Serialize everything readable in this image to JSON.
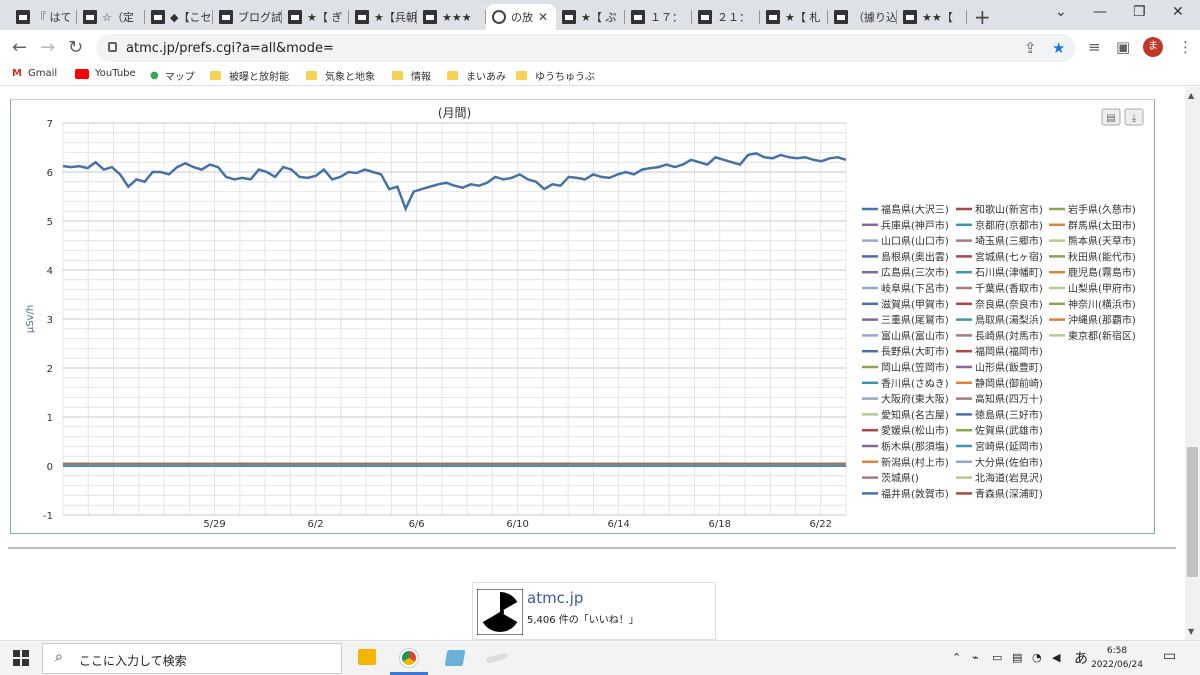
{
  "browser": {
    "tabs": [
      {
        "label": "『 はて"
      },
      {
        "label": "☆（定"
      },
      {
        "label": "◆【こセ"
      },
      {
        "label": "ブログ試"
      },
      {
        "label": "★【 ぎ"
      },
      {
        "label": "★【兵朝"
      },
      {
        "label": "★★★"
      },
      {
        "label": "の放",
        "active": true
      },
      {
        "label": "★【 ぷ"
      },
      {
        "label": "１７："
      },
      {
        "label": "２１："
      },
      {
        "label": "★【 札"
      },
      {
        "label": "（據り込"
      },
      {
        "label": "★★【"
      }
    ],
    "url": "atmc.jp/prefs.cgi?a=all&mode=",
    "avatar": "ま",
    "bookmarks": [
      "Gmail",
      "YouTube",
      "マップ",
      "被曝と放射能",
      "気象と地象",
      "情報",
      "まいあみ",
      "ゆうちゅうぶ"
    ]
  },
  "chart_data": {
    "type": "line",
    "title": "(月間)",
    "xlabel": "",
    "ylabel": "μSv/h",
    "ylim": [
      -1,
      7
    ],
    "yticks": [
      -1,
      0,
      1,
      2,
      3,
      4,
      5,
      6,
      7
    ],
    "xticks": [
      {
        "day": 6,
        "label": "5/29"
      },
      {
        "day": 10,
        "label": "6/2"
      },
      {
        "day": 14,
        "label": "6/6"
      },
      {
        "day": 18,
        "label": "6/10"
      },
      {
        "day": 22,
        "label": "6/14"
      },
      {
        "day": 26,
        "label": "6/18"
      },
      {
        "day": 30,
        "label": "6/22"
      }
    ],
    "xlim": [
      0,
      31
    ],
    "main_series": {
      "name": "福島県(大沢三)",
      "color": "#4572a7",
      "values": [
        6.12,
        6.1,
        6.12,
        6.08,
        6.2,
        6.05,
        6.1,
        5.95,
        5.7,
        5.85,
        5.8,
        6.0,
        6.0,
        5.95,
        6.1,
        6.18,
        6.1,
        6.05,
        6.15,
        6.1,
        5.9,
        5.85,
        5.88,
        5.85,
        6.05,
        6.0,
        5.9,
        6.1,
        6.05,
        5.9,
        5.88,
        5.92,
        6.05,
        5.85,
        5.9,
        6.0,
        5.98,
        6.05,
        6.0,
        5.95,
        5.65,
        5.7,
        5.25,
        5.6,
        5.65,
        5.7,
        5.75,
        5.78,
        5.72,
        5.68,
        5.75,
        5.72,
        5.78,
        5.9,
        5.85,
        5.88,
        5.95,
        5.85,
        5.8,
        5.65,
        5.75,
        5.72,
        5.9,
        5.88,
        5.85,
        5.95,
        5.9,
        5.88,
        5.95,
        6.0,
        5.95,
        6.05,
        6.08,
        6.1,
        6.15,
        6.1,
        6.15,
        6.25,
        6.2,
        6.15,
        6.3,
        6.25,
        6.2,
        6.15,
        6.35,
        6.38,
        6.3,
        6.28,
        6.35,
        6.3,
        6.28,
        6.3,
        6.25,
        6.22,
        6.28,
        6.3,
        6.25
      ]
    },
    "flat_series_value": 0.05,
    "legend": [
      {
        "name": "福島県(大沢三)",
        "color": "#4572a7"
      },
      {
        "name": "和歌山(新宮市)",
        "color": "#aa4643"
      },
      {
        "name": "岩手県(久慈市)",
        "color": "#89a54e"
      },
      {
        "name": "兵庫県(神戸市)",
        "color": "#80699b"
      },
      {
        "name": "京都府(京都市)",
        "color": "#3d96ae"
      },
      {
        "name": "群馬県(太田市)",
        "color": "#db843d"
      },
      {
        "name": "山口県(山口市)",
        "color": "#92a8cd"
      },
      {
        "name": "埼玉県(三郷市)",
        "color": "#a47d7c"
      },
      {
        "name": "熊本県(天草市)",
        "color": "#b5ca92"
      },
      {
        "name": "島根県(奥出雲)",
        "color": "#4572a7"
      },
      {
        "name": "宮城県(七ヶ宿)",
        "color": "#aa4643"
      },
      {
        "name": "秋田県(能代市)",
        "color": "#89a54e"
      },
      {
        "name": "広島県(三次市)",
        "color": "#80699b"
      },
      {
        "name": "石川県(津幡町)",
        "color": "#3d96ae"
      },
      {
        "name": "鹿児島(霧島市)",
        "color": "#db843d"
      },
      {
        "name": "岐阜県(下呂市)",
        "color": "#92a8cd"
      },
      {
        "name": "千葉県(香取市)",
        "color": "#a47d7c"
      },
      {
        "name": "山梨県(甲府市)",
        "color": "#b5ca92"
      },
      {
        "name": "滋賀県(甲賀市)",
        "color": "#4572a7"
      },
      {
        "name": "奈良県(奈良市)",
        "color": "#aa4643"
      },
      {
        "name": "神奈川(横浜市)",
        "color": "#89a54e"
      },
      {
        "name": "三重県(尾鷲市)",
        "color": "#80699b"
      },
      {
        "name": "鳥取県(湯梨浜)",
        "color": "#3d96ae"
      },
      {
        "name": "沖縄県(那覇市)",
        "color": "#db843d"
      },
      {
        "name": "富山県(富山市)",
        "color": "#92a8cd"
      },
      {
        "name": "長崎県(対馬市)",
        "color": "#a47d7c"
      },
      {
        "name": "東京都(新宿区)",
        "color": "#b5ca92"
      },
      {
        "name": "長野県(大町市)",
        "color": "#4572a7"
      },
      {
        "name": "福岡県(福岡市)",
        "color": "#aa4643"
      },
      {
        "name": "岡山県(笠岡市)",
        "color": "#89a54e"
      },
      {
        "name": "山形県(飯豊町)",
        "color": "#80699b"
      },
      {
        "name": "香川県(さぬき)",
        "color": "#3d96ae"
      },
      {
        "name": "静岡県(御前崎)",
        "color": "#db843d"
      },
      {
        "name": "大阪府(東大阪)",
        "color": "#92a8cd"
      },
      {
        "name": "高知県(四万十)",
        "color": "#a47d7c"
      },
      {
        "name": "愛知県(名古屋)",
        "color": "#b5ca92"
      },
      {
        "name": "徳島県(三好市)",
        "color": "#4572a7"
      },
      {
        "name": "愛媛県(松山市)",
        "color": "#aa4643"
      },
      {
        "name": "佐賀県(武雄市)",
        "color": "#89a54e"
      },
      {
        "name": "栃木県(那須塩)",
        "color": "#80699b"
      },
      {
        "name": "宮崎県(延岡市)",
        "color": "#3d96ae"
      },
      {
        "name": "新潟県(村上市)",
        "color": "#db843d"
      },
      {
        "name": "大分県(佐伯市)",
        "color": "#92a8cd"
      },
      {
        "name": "茨城県()",
        "color": "#a47d7c"
      },
      {
        "name": "北海道(岩見沢)",
        "color": "#b5ca92"
      },
      {
        "name": "福井県(敦賀市)",
        "color": "#4572a7"
      },
      {
        "name": "青森県(深浦町)",
        "color": "#aa4643"
      }
    ]
  },
  "facebook": {
    "name": "atmc.jp",
    "likes": "5,406 件の「いいね！」"
  },
  "taskbar": {
    "search_placeholder": "ここに入力して検索",
    "time": "6:58",
    "date": "2022/06/24",
    "ime": "あ"
  }
}
